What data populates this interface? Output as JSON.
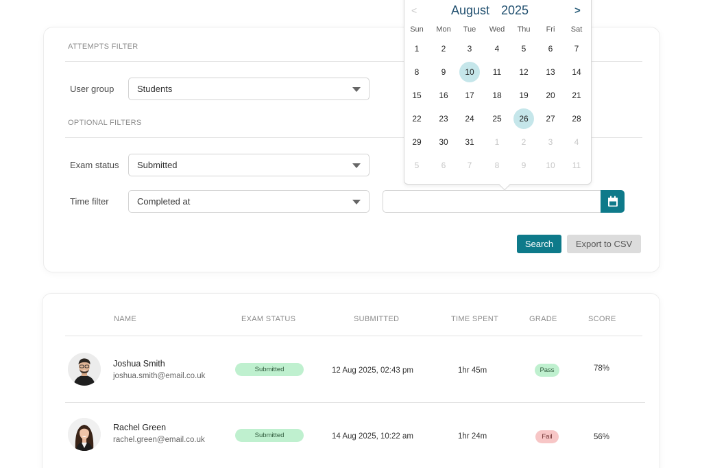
{
  "filters": {
    "attempts_title": "ATTEMPTS FILTER",
    "optional_title": "OPTIONAL FILTERS",
    "user_group": {
      "label": "User group",
      "value": "Students"
    },
    "exam_status": {
      "label": "Exam status",
      "value": "Submitted"
    },
    "time_filter": {
      "label": "Time filter",
      "value": "Completed at"
    },
    "date_value": "",
    "search_label": "Search",
    "export_label": "Export to CSV"
  },
  "calendar": {
    "prev": "<",
    "next": ">",
    "month": "August",
    "year": "2025",
    "weekdays": [
      "Sun",
      "Mon",
      "Tue",
      "Wed",
      "Thu",
      "Fri",
      "Sat"
    ],
    "weeks": [
      [
        1,
        2,
        3,
        4,
        5,
        6,
        7
      ],
      [
        8,
        9,
        10,
        11,
        12,
        13,
        14
      ],
      [
        15,
        16,
        17,
        18,
        19,
        20,
        21
      ],
      [
        22,
        23,
        24,
        25,
        26,
        27,
        28
      ],
      [
        29,
        30,
        31,
        1,
        2,
        3,
        4
      ],
      [
        5,
        6,
        7,
        8,
        9,
        10,
        11
      ]
    ],
    "out_of_month_from": {
      "week": 4,
      "day": 3
    },
    "selected_days": [
      10,
      26
    ],
    "selected_color": "#c5e6ea"
  },
  "table": {
    "headers": {
      "name": "NAME",
      "status": "EXAM STATUS",
      "submitted": "SUBMITTED",
      "time": "TIME SPENT",
      "grade": "GRADE",
      "score": "SCORE"
    },
    "rows": [
      {
        "name": "Joshua Smith",
        "email": "joshua.smith@email.co.uk",
        "status": "Submitted",
        "submitted": "12 Aug 2025, 02:43 pm",
        "time_spent": "1hr 45m",
        "grade": "Pass",
        "score": "78%"
      },
      {
        "name": "Rachel Green",
        "email": "rachel.green@email.co.uk",
        "status": "Submitted",
        "submitted": "14 Aug 2025, 10:22 am",
        "time_spent": "1hr 24m",
        "grade": "Fail",
        "score": "56%"
      }
    ]
  },
  "colors": {
    "accent": "#0e7a8a",
    "pass_bg": "#bff0cf",
    "fail_bg": "#f7c6c6",
    "submitted_bg": "#bff0cf"
  },
  "icons": {
    "calendar_button": "calendar-icon",
    "select_caret": "chevron-down-icon"
  }
}
